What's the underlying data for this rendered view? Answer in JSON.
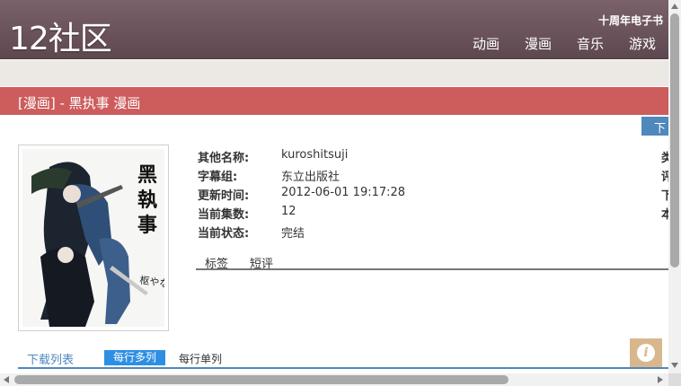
{
  "header": {
    "logo": "12社区",
    "tagline": "十周年电子书",
    "nav": [
      "动画",
      "漫画",
      "音乐",
      "游戏"
    ]
  },
  "title": "[漫画] - 黑执事 漫画",
  "download_button": "下",
  "cover": {
    "title_art": "黑執事",
    "author_art": "枢やな"
  },
  "info": {
    "rows": [
      {
        "label": "其他名称:",
        "value": "kuroshitsuji"
      },
      {
        "label": "字幕组:",
        "value": "东立出版社"
      },
      {
        "label": "更新时间:",
        "value": "2012-06-01 19:17:28"
      },
      {
        "label": "当前集数:",
        "value": "12"
      },
      {
        "label": "当前状态:",
        "value": "完结"
      }
    ],
    "right_labels": [
      "类",
      "评",
      "下",
      "本"
    ]
  },
  "tabs": [
    "标签",
    "短评"
  ],
  "list": {
    "title": "下载列表",
    "mode_multi": "每行多列",
    "mode_single": "每行单列"
  },
  "info_button_icon": "i",
  "colors": {
    "header": "#6c545d",
    "title_bar": "#cd5c5c",
    "accent": "#4f88bd",
    "mode_active": "#2d8fe3"
  }
}
